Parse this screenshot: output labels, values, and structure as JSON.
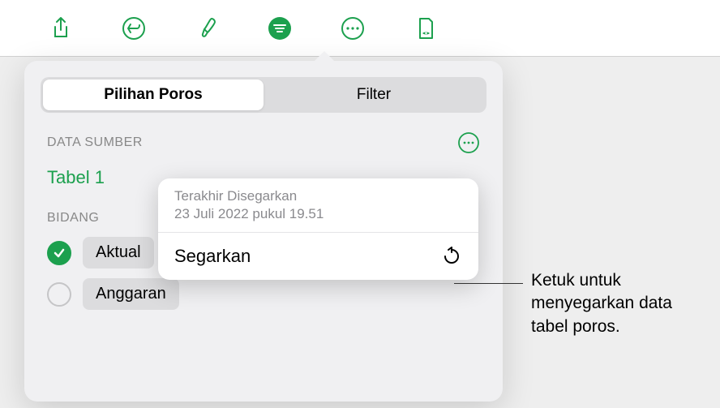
{
  "toolbar": {
    "share_icon": "share-icon",
    "undo_icon": "undo-icon",
    "format_icon": "brush-icon",
    "sort_icon": "sort-lines-icon",
    "more_icon": "more-circle-icon",
    "preview_icon": "document-preview-icon"
  },
  "tabs": {
    "pivot_options": "Pilihan Poros",
    "filter": "Filter"
  },
  "sections": {
    "data_source": "DATA SUMBER",
    "fields": "BIDANG"
  },
  "source_table": "Tabel 1",
  "fields": [
    {
      "label": "Aktual",
      "checked": true
    },
    {
      "label": "Anggaran",
      "checked": false
    }
  ],
  "refresh": {
    "last_refreshed_label": "Terakhir Disegarkan",
    "last_refreshed_date": "23 Juli 2022 pukul 19.51",
    "action_label": "Segarkan"
  },
  "callout": "Ketuk untuk menyegarkan data tabel poros.",
  "colors": {
    "accent": "#1ca04e"
  }
}
